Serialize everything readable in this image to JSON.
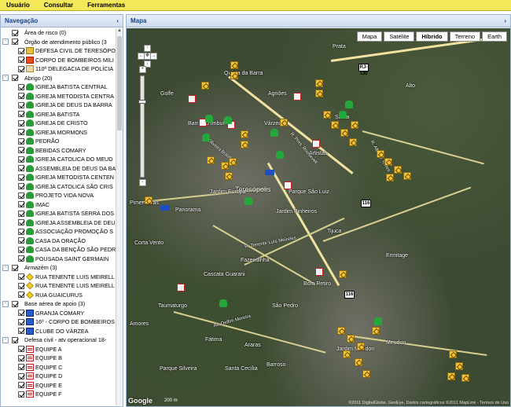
{
  "menu": {
    "items": [
      "Usuário",
      "Consultar",
      "Ferramentas"
    ]
  },
  "left_panel": {
    "title": "Navegação",
    "collapse_glyph": "‹",
    "tree": [
      {
        "level": 0,
        "expand": "",
        "checked": true,
        "icon": "blank",
        "label": "Área de risco (0)"
      },
      {
        "level": 0,
        "expand": "-",
        "checked": true,
        "icon": "blank",
        "label": "Órgão de atendimento público (3"
      },
      {
        "level": 1,
        "expand": "",
        "checked": true,
        "icon": "shield",
        "label": "DEFESA CIVIL DE TERESÓPOL"
      },
      {
        "level": 1,
        "expand": "",
        "checked": true,
        "icon": "fire",
        "label": "CORPO DE BOMBEIROS MILI"
      },
      {
        "level": 1,
        "expand": "",
        "checked": true,
        "icon": "police",
        "label": "110ª DELEGACIA DE POLÍCIA"
      },
      {
        "level": 0,
        "expand": "-",
        "checked": true,
        "icon": "blank",
        "label": "Abrigo (20)"
      },
      {
        "level": 1,
        "expand": "",
        "checked": true,
        "icon": "green",
        "label": "IGREJA BATISTA CENTRAL"
      },
      {
        "level": 1,
        "expand": "",
        "checked": true,
        "icon": "green",
        "label": "IGREJA METODISTA CENTRA"
      },
      {
        "level": 1,
        "expand": "",
        "checked": true,
        "icon": "green",
        "label": "IGREJA DE DEUS DA BARRA"
      },
      {
        "level": 1,
        "expand": "",
        "checked": true,
        "icon": "green",
        "label": "IGREJA BATISTA"
      },
      {
        "level": 1,
        "expand": "",
        "checked": true,
        "icon": "green",
        "label": "IGREJA DE CRISTO"
      },
      {
        "level": 1,
        "expand": "",
        "checked": true,
        "icon": "green",
        "label": "IGREJA MORMONS"
      },
      {
        "level": 1,
        "expand": "",
        "checked": true,
        "icon": "green",
        "label": "PEDRÃO"
      },
      {
        "level": 1,
        "expand": "",
        "checked": true,
        "icon": "green",
        "label": "BEBIDAS COMARY"
      },
      {
        "level": 1,
        "expand": "",
        "checked": true,
        "icon": "green",
        "label": "IGREJA CATOLICA DO MEUD"
      },
      {
        "level": 1,
        "expand": "",
        "checked": true,
        "icon": "green",
        "label": "ASSEMBLEIA DE DEUS DA BA"
      },
      {
        "level": 1,
        "expand": "",
        "checked": true,
        "icon": "green",
        "label": "IGREJA METODISTA CENTEN"
      },
      {
        "level": 1,
        "expand": "",
        "checked": true,
        "icon": "green",
        "label": "IGREJA CATOLICA SÃO CRIS"
      },
      {
        "level": 1,
        "expand": "",
        "checked": true,
        "icon": "green",
        "label": "PROJETO VIDA NOVA"
      },
      {
        "level": 1,
        "expand": "",
        "checked": true,
        "icon": "green",
        "label": "IMAC"
      },
      {
        "level": 1,
        "expand": "",
        "checked": true,
        "icon": "green",
        "label": "IGREJA BATISTA SERRA DOS"
      },
      {
        "level": 1,
        "expand": "",
        "checked": true,
        "icon": "green",
        "label": "IGREJA ASSEMBLEIA DE DEU"
      },
      {
        "level": 1,
        "expand": "",
        "checked": true,
        "icon": "green",
        "label": "ASSOCIAÇÃO PROMOÇÃO S"
      },
      {
        "level": 1,
        "expand": "",
        "checked": true,
        "icon": "green",
        "label": "CASA DA ORAÇÃO"
      },
      {
        "level": 1,
        "expand": "",
        "checked": true,
        "icon": "green",
        "label": "CASA DA BENÇÃO SÃO PEDR"
      },
      {
        "level": 1,
        "expand": "",
        "checked": true,
        "icon": "green",
        "label": "POUSADA SAINT GERMAIN"
      },
      {
        "level": 0,
        "expand": "-",
        "checked": true,
        "icon": "blank",
        "label": "Armazém (3)"
      },
      {
        "level": 1,
        "expand": "",
        "checked": true,
        "icon": "warn",
        "label": "RUA TENENTE LUIS MEIRELL"
      },
      {
        "level": 1,
        "expand": "",
        "checked": true,
        "icon": "warn",
        "label": "RUA TENENTE LUIS MEIRELL"
      },
      {
        "level": 1,
        "expand": "",
        "checked": true,
        "icon": "warn",
        "label": "RUA GUAICURUS"
      },
      {
        "level": 0,
        "expand": "-",
        "checked": true,
        "icon": "blank",
        "label": "Base aérea de apoio (3)"
      },
      {
        "level": 1,
        "expand": "",
        "checked": true,
        "icon": "plane",
        "label": "GRANJA COMARY"
      },
      {
        "level": 1,
        "expand": "",
        "checked": true,
        "icon": "plane",
        "label": "16º - CORPO DE BOMBEIROS"
      },
      {
        "level": 1,
        "expand": "",
        "checked": true,
        "icon": "plane",
        "label": "CLUBE DO VÁRZEA"
      },
      {
        "level": 0,
        "expand": "-",
        "checked": true,
        "icon": "blank",
        "label": "Defesa civil - atv operacional 18-"
      },
      {
        "level": 1,
        "expand": "",
        "checked": true,
        "icon": "doc",
        "label": "EQUIPE A"
      },
      {
        "level": 1,
        "expand": "",
        "checked": true,
        "icon": "doc",
        "label": "EQUIPE B"
      },
      {
        "level": 1,
        "expand": "",
        "checked": true,
        "icon": "doc",
        "label": "EQUIPE C"
      },
      {
        "level": 1,
        "expand": "",
        "checked": true,
        "icon": "doc",
        "label": "EQUIPE D"
      },
      {
        "level": 1,
        "expand": "",
        "checked": true,
        "icon": "doc",
        "label": "EQUIPE E"
      },
      {
        "level": 1,
        "expand": "",
        "checked": true,
        "icon": "doc",
        "label": "EQUIPE F"
      }
    ]
  },
  "right_panel": {
    "title": "Mapa",
    "expand_glyph": "›",
    "map_types": [
      {
        "label": "Mapa",
        "active": false
      },
      {
        "label": "Satélite",
        "active": false
      },
      {
        "label": "Híbrido",
        "active": true
      },
      {
        "label": "Terreno",
        "active": false
      },
      {
        "label": "Earth",
        "active": false
      }
    ],
    "nav": {
      "up": "↑",
      "down": "↓",
      "left": "←",
      "right": "→",
      "center": "✥",
      "zoom_in": "+",
      "zoom_out": "−"
    },
    "place_labels": [
      "Golfe",
      "Quinta da Barra",
      "Barra do Imbuí",
      "Várzea",
      "Artistas",
      "Santa",
      "Teresópolis",
      "Parque São Luiz",
      "Jardim Europa",
      "Panorama",
      "Pimenteiras",
      "Jardim Pinheiros",
      "Tijuca",
      "Corta Vento",
      "Fazendinha",
      "Ermitage",
      "Cascata Guarani",
      "Bom Retiro",
      "Taumaturgo",
      "Amores",
      "Fátima",
      "Araras",
      "São Pedro",
      "Meudon",
      "Jardim Meudon",
      "Barroso",
      "Santa Cecília",
      "Prata",
      "Alto",
      "Agriões",
      "Parque Silveira"
    ],
    "road_labels": [
      "RJ-130",
      "116",
      "116"
    ],
    "street_labels": [
      "R. Tenente Luís Meireles",
      "Av. Oliveira Botelho",
      "R. Pres. Roosevelt",
      "Av. Delfim Moreira",
      "R. Alberto Torres"
    ],
    "logo": "Google",
    "scale_text": "200 m",
    "copyright": "©2011 DigitalGlobe, GeoEye, Dados cartográficos ©2011 MapLink - Termos de Uso"
  }
}
